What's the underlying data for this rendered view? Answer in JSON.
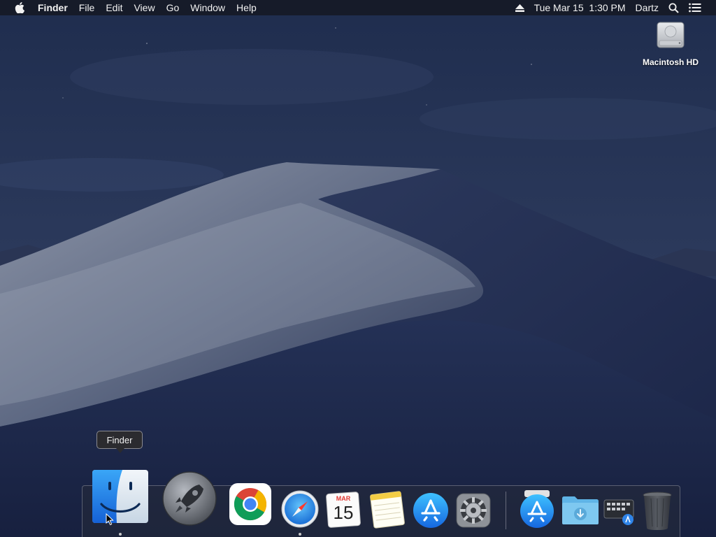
{
  "menubar": {
    "app_name": "Finder",
    "menus": [
      "File",
      "Edit",
      "View",
      "Go",
      "Window",
      "Help"
    ],
    "datetime": "Tue Mar 15  1:30 PM",
    "user": "Dartz"
  },
  "desktop": {
    "icons": [
      {
        "label": "Macintosh HD"
      }
    ]
  },
  "dock": {
    "tooltip": "Finder",
    "calendar_month": "MAR",
    "calendar_day": "15"
  },
  "colors": {
    "accent_blue": "#1e7cf2",
    "menubar_bg": "#161a26"
  }
}
